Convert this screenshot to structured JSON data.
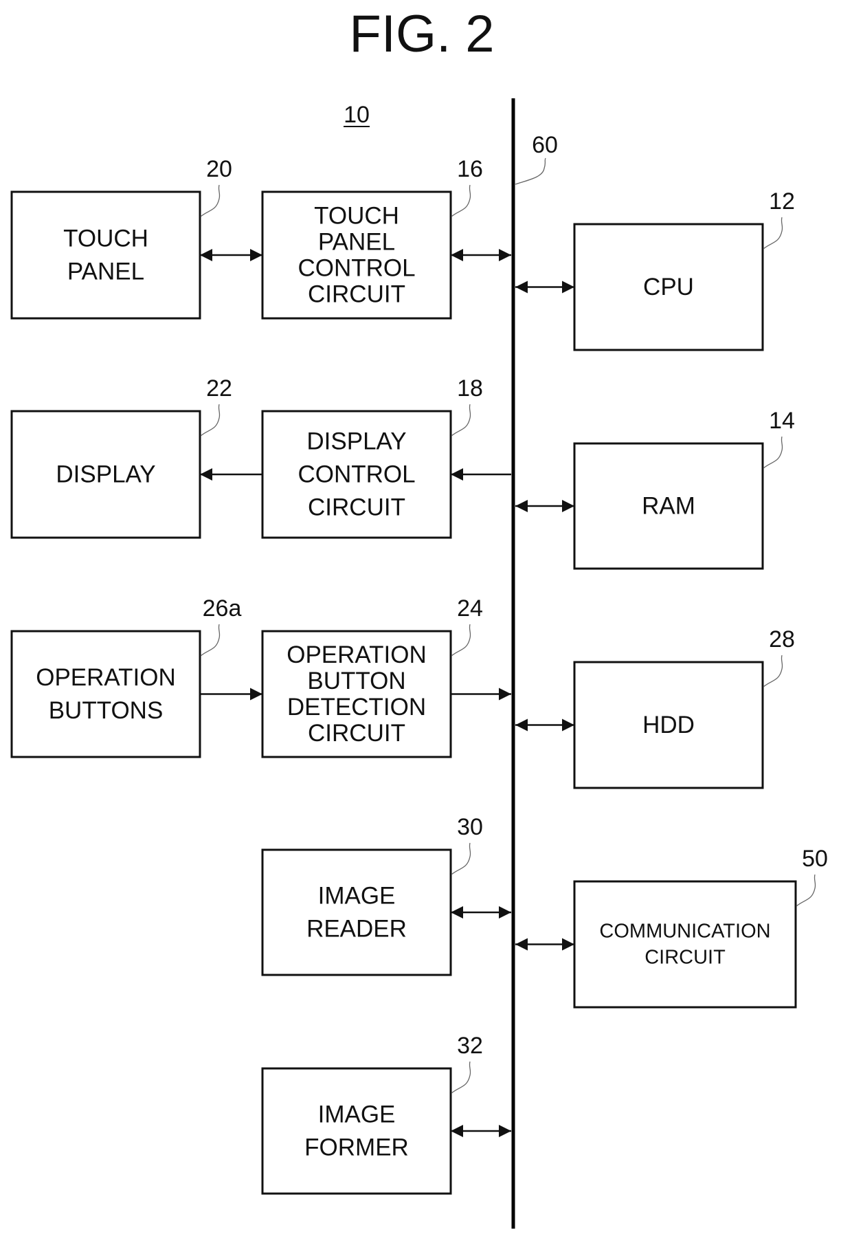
{
  "figure": {
    "title": "FIG. 2",
    "device_ref": "10",
    "bus_ref": "60"
  },
  "blocks": [
    {
      "id": "touch-panel",
      "ref": "20",
      "lines": [
        "TOUCH",
        "PANEL"
      ]
    },
    {
      "id": "touch-panel-control-circuit",
      "ref": "16",
      "lines": [
        "TOUCH",
        "PANEL",
        "CONTROL",
        "CIRCUIT"
      ]
    },
    {
      "id": "cpu",
      "ref": "12",
      "lines": [
        "CPU"
      ]
    },
    {
      "id": "display",
      "ref": "22",
      "lines": [
        "DISPLAY"
      ]
    },
    {
      "id": "display-control-circuit",
      "ref": "18",
      "lines": [
        "DISPLAY",
        "CONTROL",
        "CIRCUIT"
      ]
    },
    {
      "id": "ram",
      "ref": "14",
      "lines": [
        "RAM"
      ]
    },
    {
      "id": "operation-buttons",
      "ref": "26a",
      "lines": [
        "OPERATION",
        "BUTTONS"
      ]
    },
    {
      "id": "operation-button-detection-circuit",
      "ref": "24",
      "lines": [
        "OPERATION",
        "BUTTON",
        "DETECTION",
        "CIRCUIT"
      ]
    },
    {
      "id": "hdd",
      "ref": "28",
      "lines": [
        "HDD"
      ]
    },
    {
      "id": "image-reader",
      "ref": "30",
      "lines": [
        "IMAGE",
        "READER"
      ]
    },
    {
      "id": "communication-circuit",
      "ref": "50",
      "lines": [
        "COMMUNICATION",
        "CIRCUIT"
      ]
    },
    {
      "id": "image-former",
      "ref": "32",
      "lines": [
        "IMAGE",
        "FORMER"
      ]
    }
  ],
  "connections": [
    {
      "from": "touch-panel",
      "to": "touch-panel-control-circuit",
      "direction": "bidirectional"
    },
    {
      "from": "touch-panel-control-circuit",
      "to": "bus",
      "direction": "bidirectional"
    },
    {
      "from": "bus",
      "to": "cpu",
      "direction": "bidirectional"
    },
    {
      "from": "display-control-circuit",
      "to": "display",
      "direction": "one-way"
    },
    {
      "from": "bus",
      "to": "display-control-circuit",
      "direction": "one-way"
    },
    {
      "from": "bus",
      "to": "ram",
      "direction": "bidirectional"
    },
    {
      "from": "operation-buttons",
      "to": "operation-button-detection-circuit",
      "direction": "one-way"
    },
    {
      "from": "operation-button-detection-circuit",
      "to": "bus",
      "direction": "one-way"
    },
    {
      "from": "bus",
      "to": "hdd",
      "direction": "bidirectional"
    },
    {
      "from": "image-reader",
      "to": "bus",
      "direction": "bidirectional"
    },
    {
      "from": "bus",
      "to": "communication-circuit",
      "direction": "bidirectional"
    },
    {
      "from": "image-former",
      "to": "bus",
      "direction": "bidirectional"
    }
  ]
}
